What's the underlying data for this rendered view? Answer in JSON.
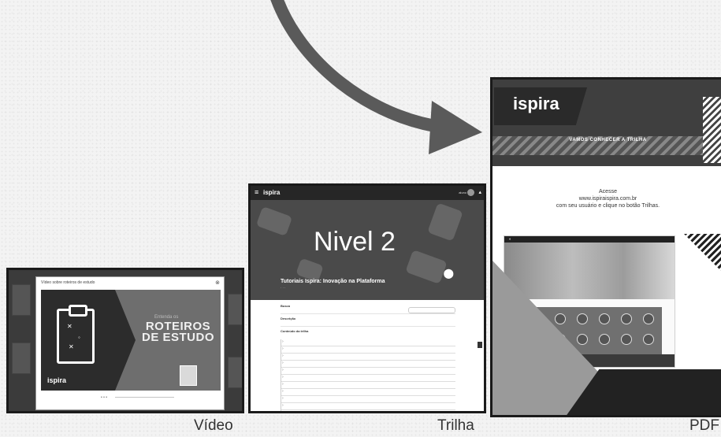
{
  "captions": {
    "video": "Vídeo",
    "trilha": "Trilha",
    "pdf": "PDF"
  },
  "video_card": {
    "modal_title": "Vídeo sobre roteiros de estudo",
    "overline": "Entenda os",
    "headline_line1": "ROTEIROS",
    "headline_line2": "DE ESTUDO",
    "logo": "ispira"
  },
  "trilha_card": {
    "nav_logo": "ispira",
    "nav_user": "aluno",
    "level_title": "Nivel 2",
    "course_title": "Tutoriais Ispira: Inovação na Plataforma",
    "section_label": "Busca",
    "description_label": "Descrição",
    "list_label": "Conteúdo da trilha"
  },
  "pdf_card": {
    "logo": "ispira",
    "banner_prefix": "VAMOS CONHECER A",
    "banner_highlight": "TRILHA",
    "text_line1": "Acesse",
    "text_line2": "www.ispiraispira.com.br",
    "text_line3": "com seu usuário e clique no botão Trilhas."
  },
  "colors": {
    "page_background": "#f3f3f3",
    "card_dark": "#2a2a2a",
    "arrow": "#555555"
  },
  "icons": {
    "arrow": "curved-arrow-icon",
    "clipboard": "clipboard-icon",
    "close": "close-icon",
    "menu": "menu-icon",
    "pin": "location-pin-icon",
    "bell": "bell-icon"
  }
}
